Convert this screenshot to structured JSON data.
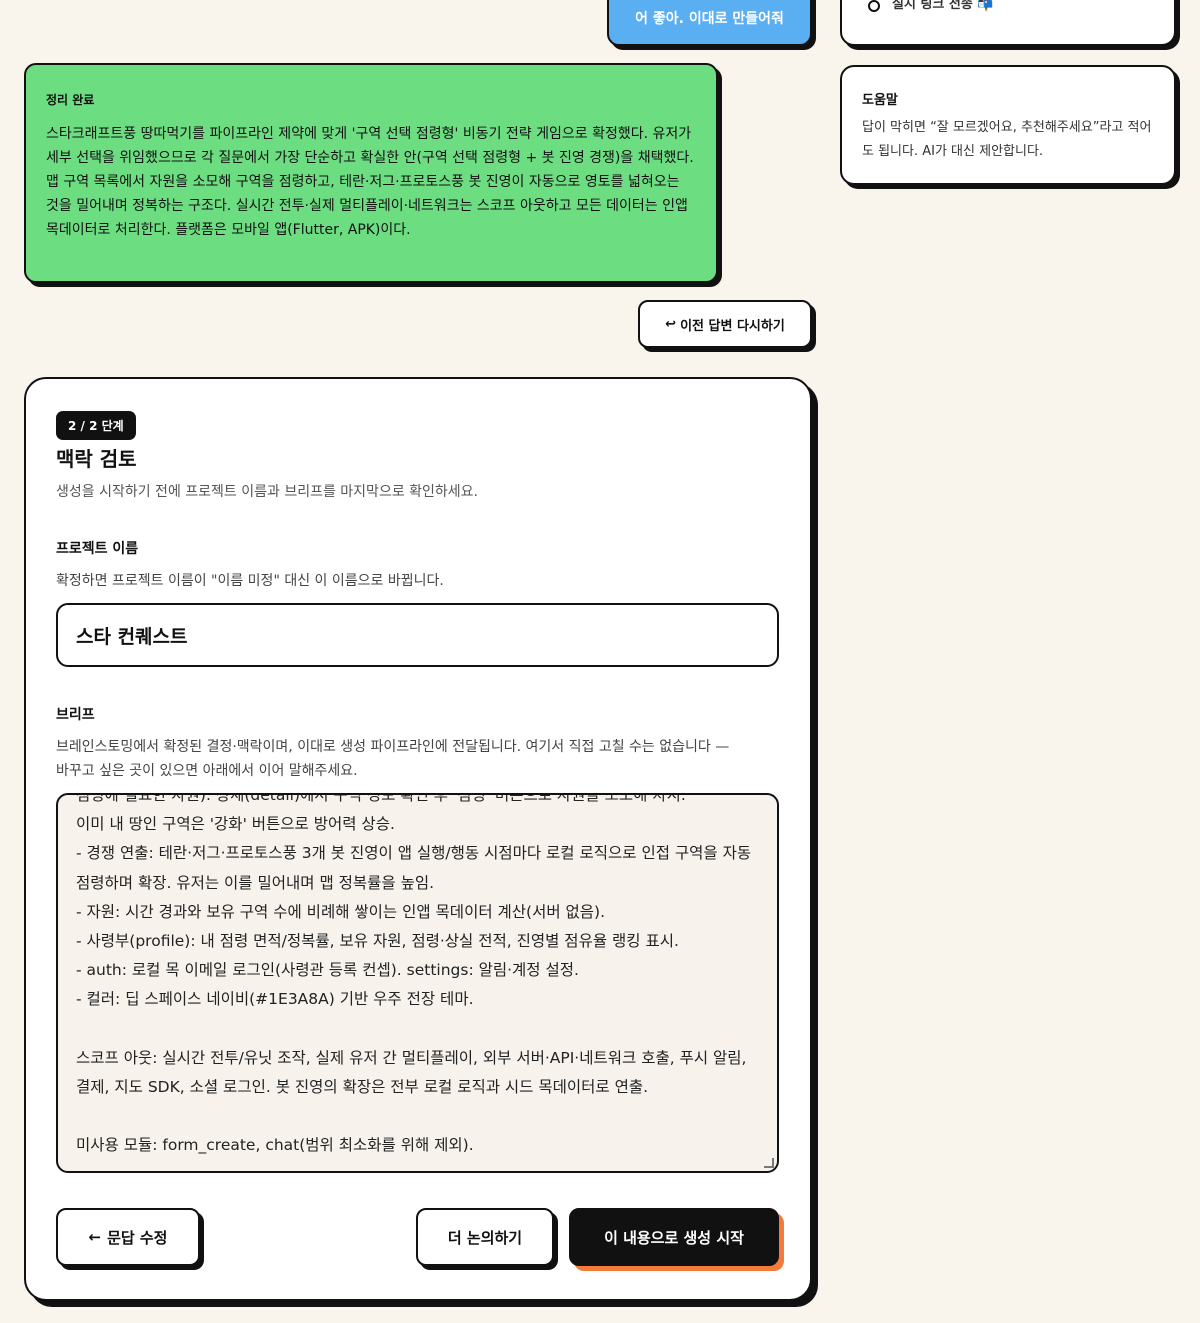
{
  "chat": {
    "user_message": "어 좋아. 이대로 만들어줘",
    "summary": {
      "title": "정리 완료",
      "text": "스타크래프트풍 땅따먹기를 파이프라인 제약에 맞게 '구역 선택 점령형' 비동기 전략 게임으로 확정했다. 유저가 세부 선택을 위임했으므로 각 질문에서 가장 단순하고 확실한 안(구역 선택 점령형 + 봇 진영 경쟁)을 채택했다. 맵 구역 목록에서 자원을 소모해 구역을 점령하고, 테란·저그·프로토스풍 봇 진영이 자동으로 영토를 넓혀오는 것을 밀어내며 정복하는 구조다. 실시간 전투·실제 멀티플레이·네트워크는 스코프 아웃하고 모든 데이터는 인앱 목데이터로 처리한다. 플랫폼은 모바일 앱(Flutter, APK)이다."
    },
    "redo_label": "이전 답변 다시하기",
    "redo_icon": "↩"
  },
  "side": {
    "checklist_item": "실시 링크 전송 📬",
    "help_title": "도움말",
    "help_text": "답이 막히면 “잘 모르겠어요, 추천해주세요”라고 적어도 됩니다. AI가 대신 제안합니다."
  },
  "review": {
    "step_badge": "2 / 2 단계",
    "title": "맥락 검토",
    "subtitle": "생성을 시작하기 전에 프로젝트 이름과 브리프를 마지막으로 확인하세요.",
    "project_name_label": "프로젝트 이름",
    "project_name_help": "확정하면 프로젝트 이름이 \"이름 미정\" 대신 이 이름으로 바뀝니다.",
    "project_name_value": "스타 컨퀘스트",
    "brief_label": "브리프",
    "brief_help": "브레인스토밍에서 확정된 결정·맥락이며, 이대로 생성 파이프라인에 전달됩니다. 여기서 직접 고칠 수는 없습니다 — 바꾸고 싶은 곳이 있으면 아래에서 이어 말해주세요.",
    "brief_text": "점령에 필요한 자원). 상세(detail)에서 구역 정보 확인 후 '점령' 버튼으로 자원을 소모해 차지.\n이미 내 땅인 구역은 '강화' 버튼으로 방어력 상승.\n- 경쟁 연출: 테란·저그·프로토스풍 3개 봇 진영이 앱 실행/행동 시점마다 로컬 로직으로 인접 구역을 자동 점령하며 확장. 유저는 이를 밀어내며 맵 정복률을 높임.\n- 자원: 시간 경과와 보유 구역 수에 비례해 쌓이는 인앱 목데이터 계산(서버 없음).\n- 사령부(profile): 내 점령 면적/정복률, 보유 자원, 점령·상실 전적, 진영별 점유율 랭킹 표시.\n- auth: 로컬 목 이메일 로그인(사령관 등록 컨셉). settings: 알림·계정 설정.\n- 컬러: 딥 스페이스 네이비(#1E3A8A) 기반 우주 전장 테마.\n\n스코프 아웃: 실시간 전투/유닛 조작, 실제 유저 간 멀티플레이, 외부 서버·API·네트워크 호출, 푸시 알림, 결제, 지도 SDK, 소셜 로그인. 봇 진영의 확장은 전부 로컬 로직과 시드 목데이터로 연출.\n\n미사용 모듈: form_create, chat(범위 최소화를 위해 제외).",
    "back_label": "문답 수정",
    "back_icon": "←",
    "discuss_label": "더 논의하기",
    "start_label": "이 내용으로 생성 시작"
  },
  "colors": {
    "background": "#faf5ec",
    "summary_green": "#6ddd82",
    "user_bubble_blue": "#5aaef2",
    "accent_orange": "#f37a3a"
  }
}
